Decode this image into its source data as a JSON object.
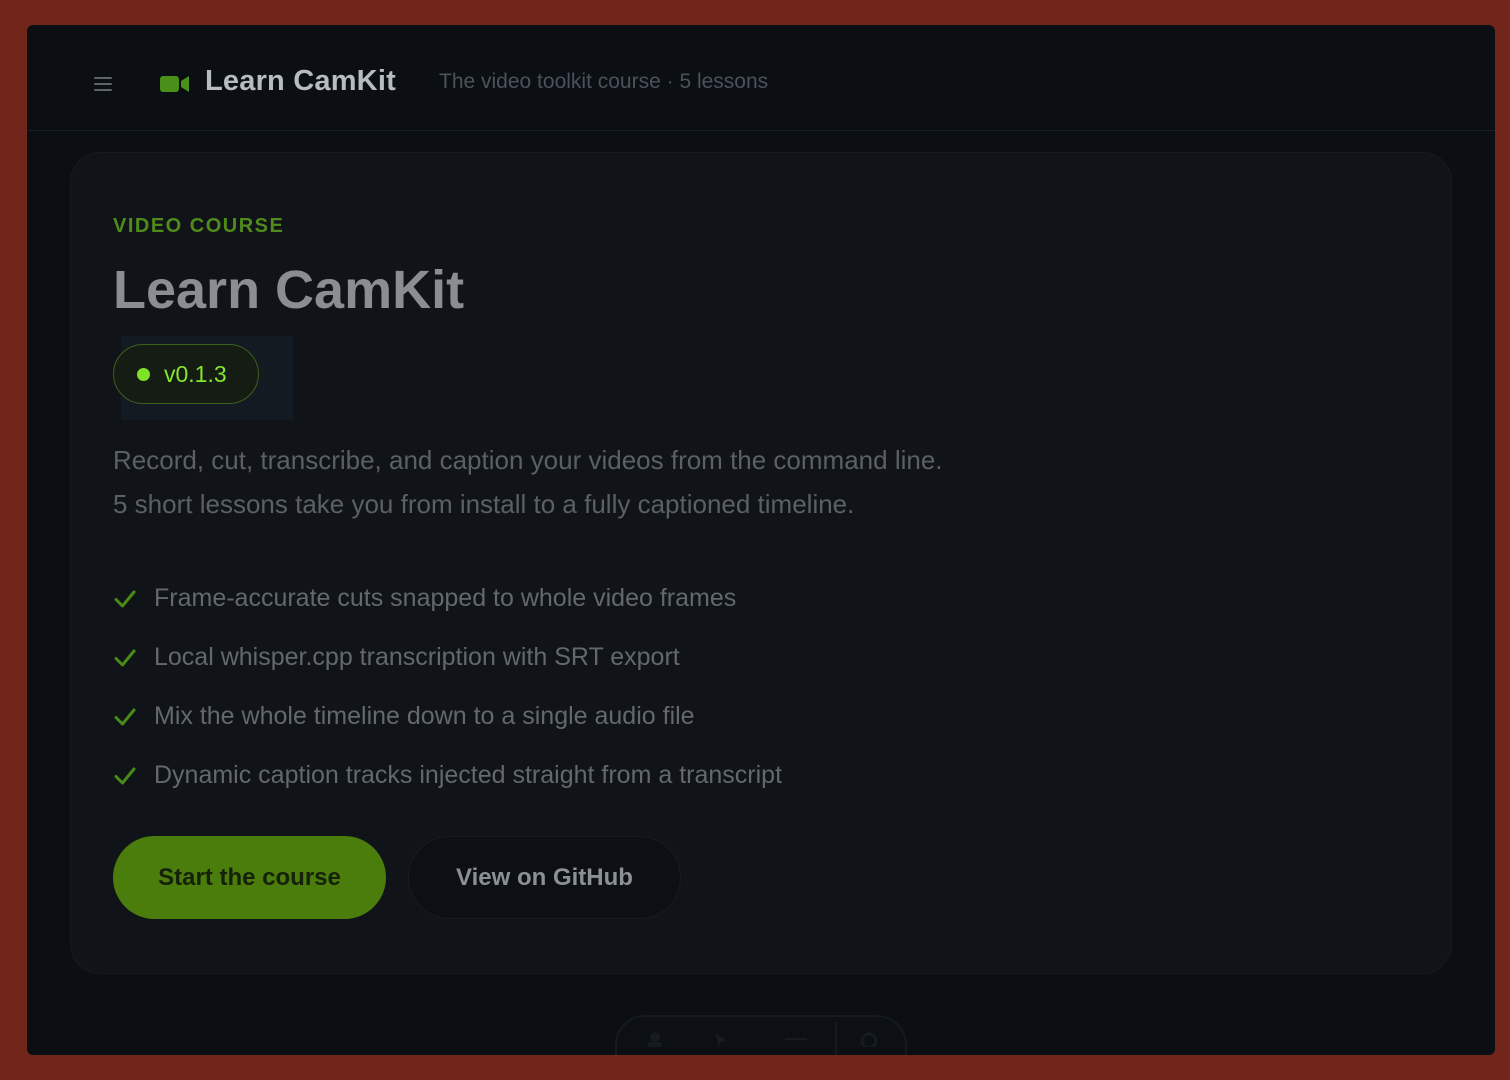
{
  "header": {
    "title": "Learn CamKit",
    "subtitle": "The video toolkit course · 5 lessons"
  },
  "hero": {
    "eyebrow": "VIDEO COURSE",
    "title": "Learn CamKit",
    "version": "v0.1.3",
    "description_line1": "Record, cut, transcribe, and caption your videos from the command line.",
    "description_line2": "5 short lessons take you from install to a fully captioned timeline.",
    "features": [
      "Frame-accurate cuts snapped to whole video frames",
      "Local whisper.cpp transcription with SRT export",
      "Mix the whole timeline down to a single audio file",
      "Dynamic caption tracks injected straight from a transcript"
    ],
    "primary_button": "Start the course",
    "secondary_button": "View on GitHub"
  },
  "icons": {
    "menu": "hamburger-icon",
    "logo": "video-camera-icon",
    "check": "check-icon"
  },
  "colors": {
    "accent": "#7ee227",
    "page_frame": "#72251a",
    "background": "#0b0f14"
  }
}
